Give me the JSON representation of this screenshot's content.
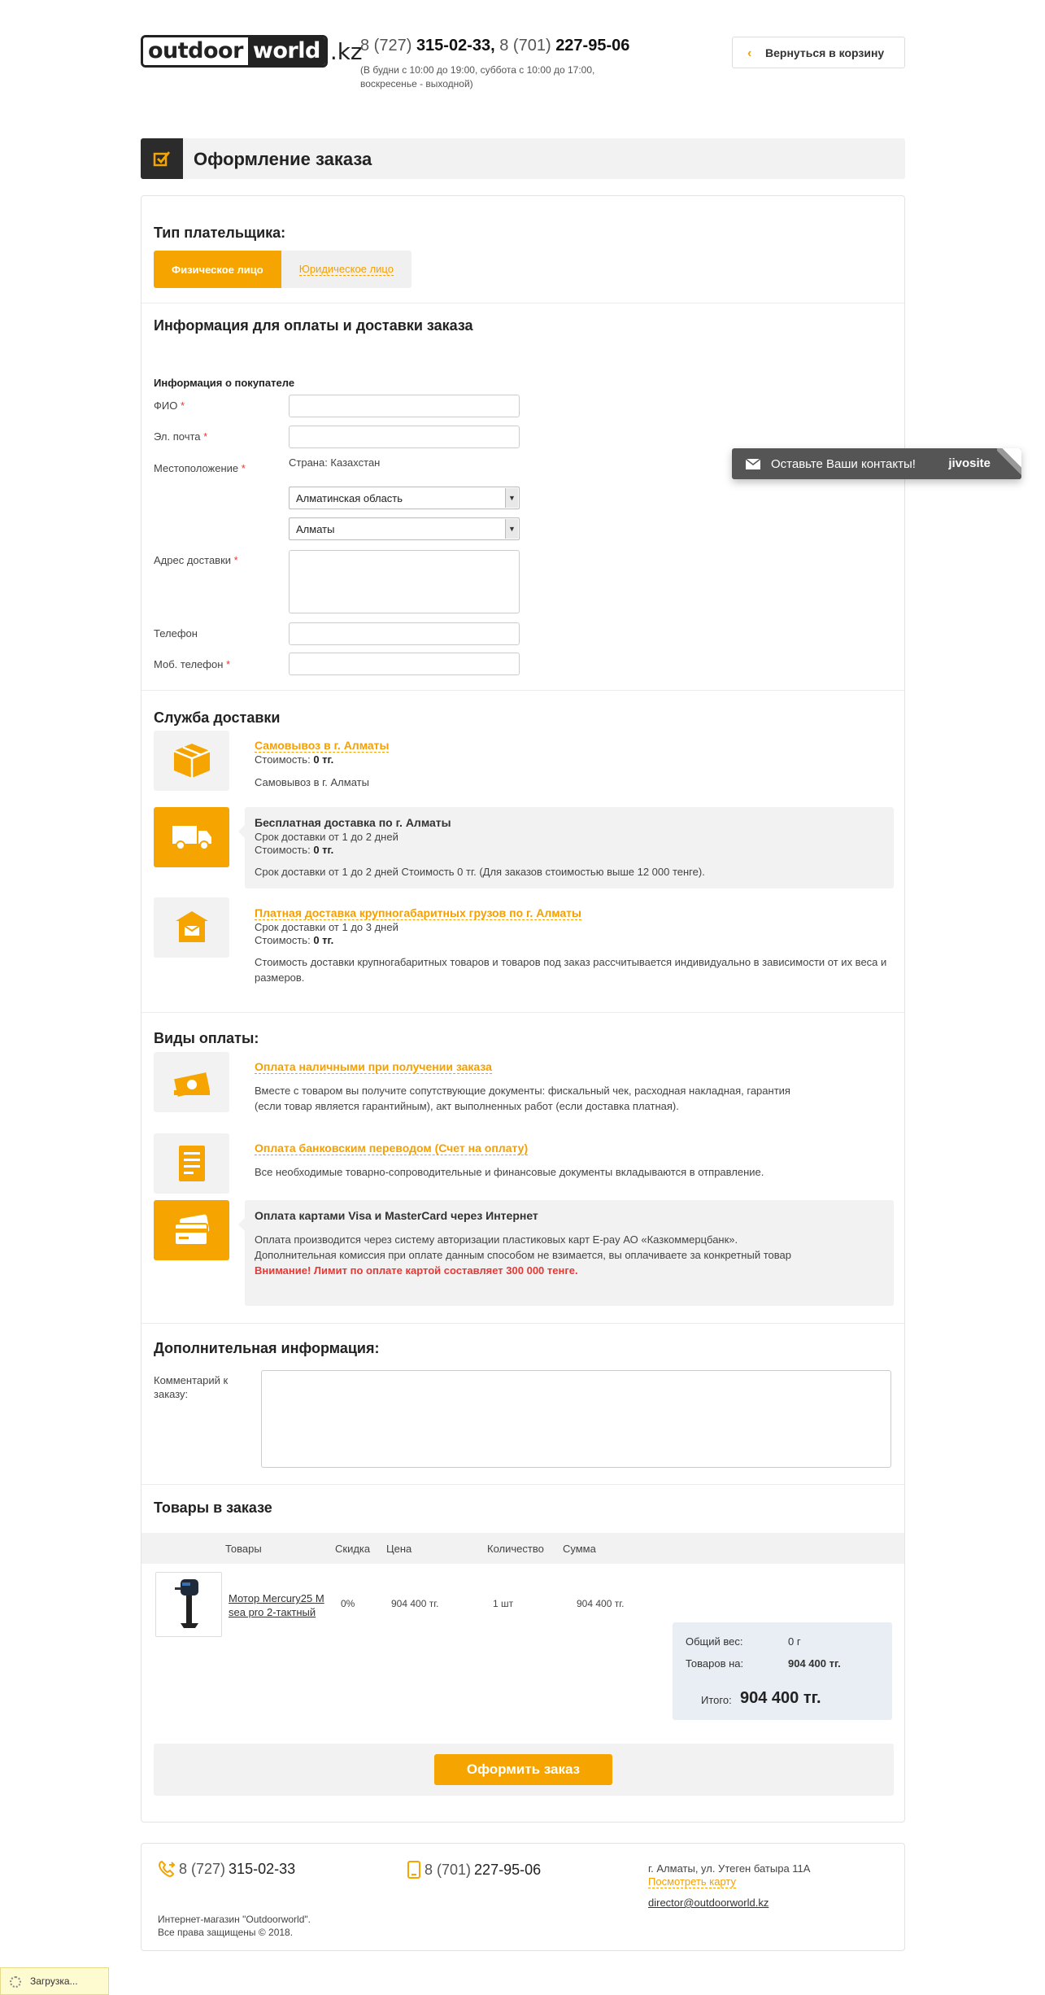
{
  "header": {
    "logo_outdoor": "outdoor",
    "logo_world": "world",
    "logo_kz": ".kz",
    "phone1_code": "8 (727)",
    "phone1_num": "315-02-33,",
    "phone2_code": "8 (701)",
    "phone2_num": "227-95-06",
    "hours": "(В будни с 10:00 до 19:00, суббота с 10:00 до 17:00, воскресенье - выходной)",
    "back_label": "Вернуться в корзину"
  },
  "page_title": "Оформление заказа",
  "payer": {
    "heading": "Тип плательщика:",
    "tabs": [
      {
        "label": "Физическое лицо"
      },
      {
        "label": "Юридическое лицо"
      }
    ]
  },
  "info": {
    "heading": "Информация для оплаты и доставки заказа",
    "buyer_heading": "Информация о покупателе",
    "fields": {
      "fio": "ФИО",
      "email": "Эл. почта",
      "location": "Местоположение",
      "address": "Адрес доставки",
      "phone": "Телефон",
      "mobile": "Моб. телефон"
    },
    "country": "Страна: Казахстан",
    "region": "Алматинская область",
    "city": "Алматы",
    "required_mark": "*"
  },
  "delivery": {
    "heading": "Служба доставки",
    "options": [
      {
        "title": "Самовывоз в г. Алматы",
        "cost_label": "Стоимость:",
        "cost": "0 тг.",
        "desc": "Самовывоз в г. Алматы"
      },
      {
        "title": "Бесплатная доставка по г. Алматы",
        "term": "Срок доставки от 1 до 2 дней",
        "cost_label": "Стоимость:",
        "cost": "0 тг.",
        "desc": "Срок доставки от 1 до 2 дней Стоимость 0 тг. (Для заказов стоимостью выше 12 000 тенге)."
      },
      {
        "title": "Платная доставка крупногабаритных грузов по г. Алматы",
        "term": "Срок доставки от 1 до 3 дней",
        "cost_label": "Стоимость:",
        "cost": "0 тг.",
        "desc1": "Стоимость доставки крупногабаритных товаров и товаров под заказ рассчитывается индивидуально в зависимости от их веса и",
        "desc2": "размеров."
      }
    ]
  },
  "payment": {
    "heading": "Виды оплаты:",
    "options": [
      {
        "title": "Оплата наличными при получении заказа",
        "desc1": "Вместе с товаром вы получите сопутствующие документы:  фискальный чек, расходная накладная, гарантия",
        "desc2": "(если товар является гарантийным), акт выполненных работ (если доставка платная)."
      },
      {
        "title": "Оплата банковским переводом (Счет на оплату)",
        "desc1": "Все необходимые товарно-сопроводительные и финансовые документы вкладываются в отправление."
      },
      {
        "title": "Оплата картами Visa и MasterCard через Интернет",
        "desc1": "Оплата производится через систему авторизации пластиковых карт E-pay АО «Казкоммерцбанк».",
        "desc2": "Дополнительная комиссия при оплате данным способом не взимается, вы оплачиваете за конкретный товар",
        "warning": "Внимание! Лимит по оплате картой составляет 300 000 тенге."
      }
    ]
  },
  "extra": {
    "heading": "Дополнительная информация:",
    "comment_label": "Комментарий к заказу:"
  },
  "order": {
    "heading": "Товары в заказе",
    "columns": [
      "Товары",
      "Скидка",
      "Цена",
      "Количество",
      "Сумма"
    ],
    "items": [
      {
        "name": "Мотор Mercury25 M sea pro 2-тактный",
        "discount": "0%",
        "price": "904 400 тг.",
        "qty": "1 шт",
        "sum": "904 400 тг."
      }
    ],
    "summary": {
      "weight_label": "Общий вес:",
      "weight": "0 г",
      "goods_label": "Товаров на:",
      "goods": "904 400 тг.",
      "total_label": "Итого:",
      "total": "904 400 тг."
    },
    "submit_label": "Оформить заказ"
  },
  "footer": {
    "phone1_code": "8 (727)",
    "phone1_num": "315-02-33",
    "phone2_code": "8 (701)",
    "phone2_num": "227-95-06",
    "address": "г. Алматы, ул. Утеген батыра 11А",
    "map_link": "Посмотреть карту",
    "email": "director@outdoorworld.kz",
    "copy1": "Интернет-магазин \"Outdoorworld\".",
    "copy2": "Все права защищены © 2018."
  },
  "chat": {
    "label": "Оставьте Ваши контакты!",
    "brand": "jivosite"
  },
  "loading": "Загрузка...",
  "colors": {
    "accent": "#f5a400",
    "dark": "#2b2b2b",
    "panel": "#f2f2f2",
    "warning": "#e53935"
  }
}
